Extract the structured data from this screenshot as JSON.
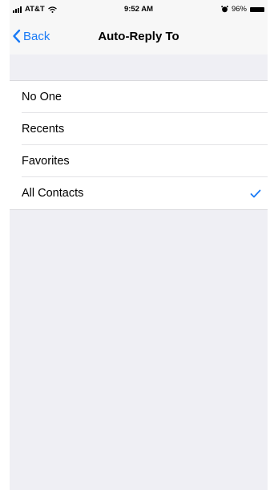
{
  "status_bar": {
    "carrier": "AT&T",
    "time": "9:52 AM",
    "battery": "96%",
    "icons": [
      "signal-icon",
      "wifi-icon",
      "alarm-icon",
      "battery-icon"
    ]
  },
  "nav": {
    "back_label": "Back",
    "title": "Auto-Reply To",
    "back_icon": "chevron-left-icon"
  },
  "options": [
    {
      "label": "No One",
      "selected": false
    },
    {
      "label": "Recents",
      "selected": false
    },
    {
      "label": "Favorites",
      "selected": false
    },
    {
      "label": "All Contacts",
      "selected": true
    }
  ],
  "colors": {
    "accent": "#1a7bf6",
    "background": "#efeff4",
    "bar": "#f7f7f7"
  }
}
